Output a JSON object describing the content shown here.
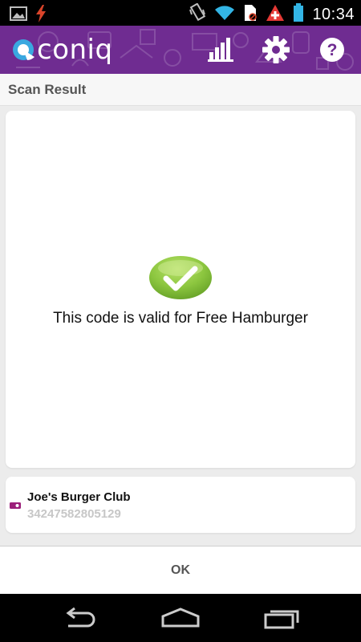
{
  "status_bar": {
    "time": "10:34",
    "icons": [
      "gallery-icon",
      "flash-icon",
      "vibrate-icon",
      "wifi-icon",
      "sim-icon",
      "alert-icon",
      "battery-icon"
    ]
  },
  "app_bar": {
    "logo_text": "coniq",
    "icons": [
      "stats-icon",
      "gear-icon",
      "help-icon"
    ],
    "color": "#6f2c91"
  },
  "subheader": {
    "title": "Scan Result"
  },
  "result": {
    "icon": "checkmark-icon",
    "message": "This code is valid for Free Hamburger"
  },
  "club": {
    "icon": "card-icon",
    "name": "Joe's Burger Club",
    "number": "34247582805129"
  },
  "ok_button": {
    "label": "OK"
  },
  "nav_bar": {
    "icons": [
      "back-icon",
      "home-icon",
      "recent-apps-icon"
    ]
  }
}
